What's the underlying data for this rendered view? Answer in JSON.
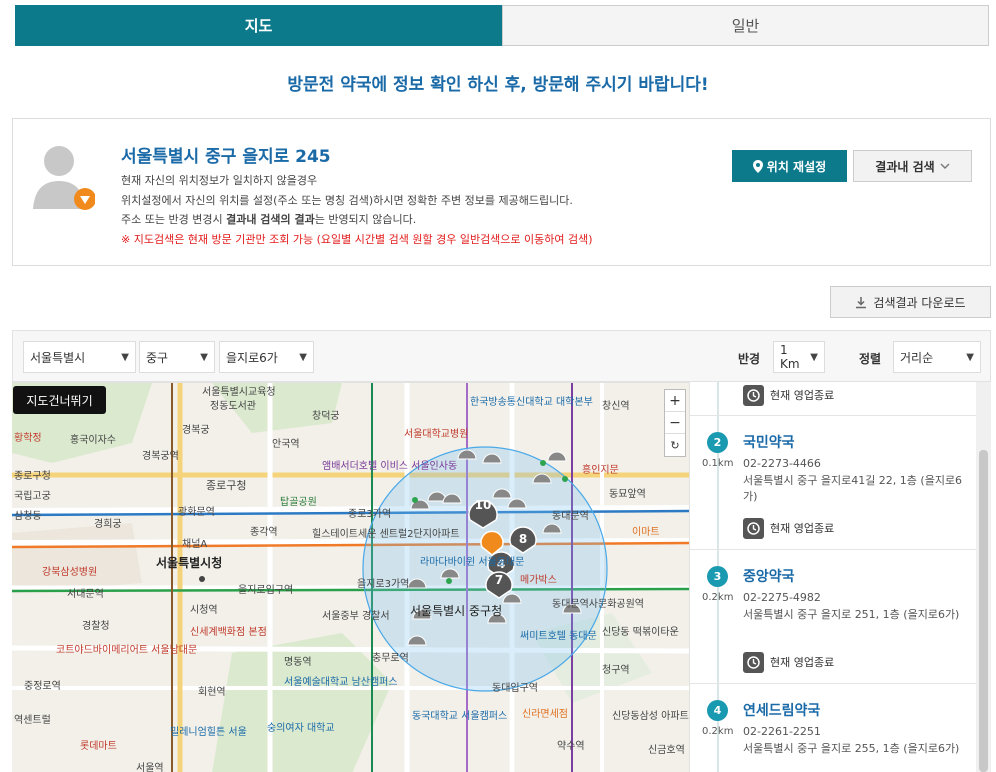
{
  "tabs": {
    "map": "지도",
    "general": "일반"
  },
  "notice": "방문전 약국에 정보 확인 하신 후, 방문해 주시기 바랍니다!",
  "location": {
    "address": "서울특별시 중구 을지로 245",
    "line1": "현재 자신의 위치정보가 일치하지 않을경우",
    "line2": "위치설정에서 자신의 위치를 설정(주소 또는 명칭 검색)하시면 정확한 주변 정보를 제공해드립니다.",
    "line3a": "주소 또는 반경 변경시 ",
    "line3b": "결과내 검색의 결과",
    "line3c": "는 반영되지 않습니다.",
    "warning": "※ 지도검색은 현재 방문 기관만 조회 가능 (요일별 시간별 검색 원할 경우 일반검색으로 이동하여 검색)",
    "reset_btn": "위치 재설정",
    "search_in_btn": "결과내 검색"
  },
  "download_btn": "검색결과 다운로드",
  "filters": {
    "city": "서울특별시",
    "district": "중구",
    "dong": "을지로6가",
    "radius_label": "반경",
    "radius": "1 Km",
    "sort_label": "정렬",
    "sort": "거리순"
  },
  "map": {
    "skip_btn": "지도건너뛰기",
    "zoom_in": "+",
    "zoom_out": "−",
    "reset": "↻",
    "cluster_labels": [
      "10",
      "8",
      "4",
      "7"
    ],
    "place_labels": [
      "서울특별시교육청",
      "정동도서관",
      "경복궁",
      "종로구청",
      "창덕궁",
      "서울대학교병원",
      "한국방송통신대학교 대학본부",
      "창신역",
      "앰배서더호텔 이비스 서울인사동",
      "탑골공원",
      "종로3가역",
      "동묘앞역",
      "경희궁",
      "광화문역",
      "종각역",
      "힐스테이트세운 센트럴2단지아파트",
      "동대문역",
      "이마트",
      "서울특별시청",
      "을지로입구역",
      "을지로3가역",
      "강북삼성병원",
      "시청역",
      "서대문역",
      "경찰청",
      "신세계백화점 본점",
      "서울중부 경찰서",
      "서울특별시 중구청",
      "코트야드바이메리어트 서울남대문",
      "명동역",
      "충무로역",
      "서울예술대학교 남산캠퍼스",
      "동대입구역",
      "동국대학교 서울캠퍼스",
      "신라면세점",
      "회현역",
      "숭의여자 대학교",
      "밀레니엄힐튼 서울",
      "롯데마트",
      "서울역",
      "약수역",
      "청구역",
      "신당동 떡볶이타운",
      "신당동삼성 아파트",
      "신금호역",
      "동대문역사문화공원역",
      "메가박스",
      "라마다바이윈 서울동대문",
      "써미트호텔 동대문",
      "홍국이자수",
      "흥인지문",
      "황학정",
      "국립고궁",
      "안국역",
      "삼청동",
      "경복궁역",
      "종로구청",
      "중정로역",
      "채널A",
      "역센트럴"
    ]
  },
  "list": [
    {
      "num": "",
      "name": "",
      "dist": "",
      "phone": "",
      "addr": "",
      "status": "현재 영업종료"
    },
    {
      "num": "2",
      "name": "국민약국",
      "dist": "0.1km",
      "phone": "02-2273-4466",
      "addr": "서울특별시 중구 을지로41길 22, 1층 (을지로6가)",
      "status": "현재 영업종료"
    },
    {
      "num": "3",
      "name": "중앙약국",
      "dist": "0.2km",
      "phone": "02-2275-4982",
      "addr": "서울특별시 중구 을지로 251, 1층 (을지로6가)",
      "status": "현재 영업종료"
    },
    {
      "num": "4",
      "name": "연세드림약국",
      "dist": "0.2km",
      "phone": "02-2261-2251",
      "addr": "서울특별시 중구 을지로 255, 1층 (을지로6가)",
      "status": ""
    }
  ],
  "colors": {
    "primary": "#0d7a8c",
    "accent": "#1a6aa8",
    "warning": "#e21b1b",
    "pin_green": "#2ea44f",
    "pin_orange": "#f08a1c"
  }
}
